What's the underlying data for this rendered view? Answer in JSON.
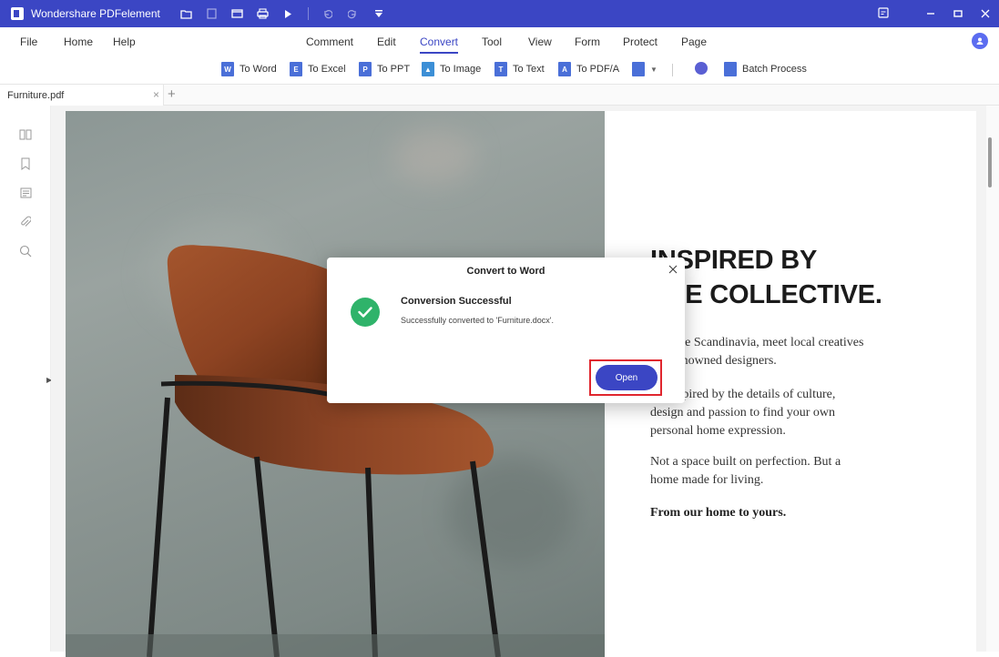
{
  "app": {
    "title": "Wondershare PDFelement",
    "accent_color": "#3b46c4"
  },
  "quick_access": [
    "folder-icon",
    "save-icon",
    "mail-icon",
    "print-icon",
    "share-icon",
    "undo-icon",
    "redo-icon",
    "dropdown-icon"
  ],
  "window_controls": [
    "message-icon",
    "minimize-icon",
    "maximize-icon",
    "close-icon"
  ],
  "menu": {
    "file": "File",
    "home": "Home",
    "help": "Help",
    "comment": "Comment",
    "edit": "Edit",
    "convert": "Convert",
    "tool": "Tool",
    "view": "View",
    "form": "Form",
    "protect": "Protect",
    "page": "Page",
    "active": "Convert"
  },
  "ribbon": {
    "to_word": "To Word",
    "to_excel": "To Excel",
    "to_ppt": "To PPT",
    "to_image": "To Image",
    "to_text": "To Text",
    "to_pdfa": "To PDF/A",
    "batch_process": "Batch Process"
  },
  "tabs": {
    "doc_name": "Furniture.pdf"
  },
  "sidebar_icons": [
    "thumbnail-icon",
    "bookmark-icon",
    "comment-icon",
    "attachment-icon",
    "search-icon"
  ],
  "document": {
    "headline_1": "INSPIRED BY",
    "headline_2": "THE COLLECTIVE.",
    "para1_line1": "Explore Scandinavia, meet local creatives",
    "para1_line2": "and renowned designers.",
    "para2_line1": "Be inspired by the details of culture,",
    "para2_line2": "design and passion to find your own",
    "para2_line3": "personal home expression.",
    "para3_line1": "Not a space built on perfection. But a",
    "para3_line2": "home made for living.",
    "para4": "From our home to yours."
  },
  "dialog": {
    "title": "Convert to Word",
    "heading": "Conversion Successful",
    "message": "Successfully converted to 'Furniture.docx'.",
    "open_button": "Open",
    "success_color": "#2fb36a",
    "highlight_color": "#e0262e"
  }
}
